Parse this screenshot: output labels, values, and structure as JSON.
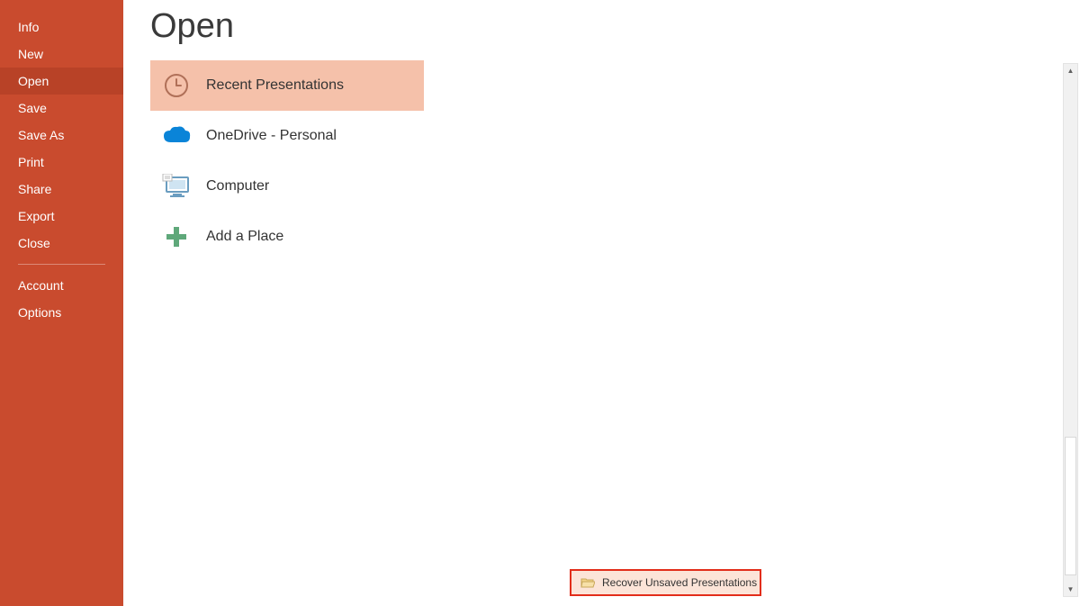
{
  "sidebar": {
    "items": [
      {
        "label": "Info"
      },
      {
        "label": "New"
      },
      {
        "label": "Open"
      },
      {
        "label": "Save"
      },
      {
        "label": "Save As"
      },
      {
        "label": "Print"
      },
      {
        "label": "Share"
      },
      {
        "label": "Export"
      },
      {
        "label": "Close"
      }
    ],
    "footer_items": [
      {
        "label": "Account"
      },
      {
        "label": "Options"
      }
    ]
  },
  "page": {
    "title": "Open"
  },
  "locations": [
    {
      "label": "Recent Presentations",
      "icon": "clock",
      "selected": true
    },
    {
      "label": "OneDrive - Personal",
      "icon": "onedrive",
      "selected": false
    },
    {
      "label": "Computer",
      "icon": "computer",
      "selected": false
    },
    {
      "label": "Add a Place",
      "icon": "plus",
      "selected": false
    }
  ],
  "recover": {
    "label": "Recover Unsaved Presentations"
  },
  "colors": {
    "accent": "#c94b2e",
    "selected_bg": "#f5c1aa",
    "onedrive": "#0078d4",
    "plus": "#5fa87a"
  }
}
